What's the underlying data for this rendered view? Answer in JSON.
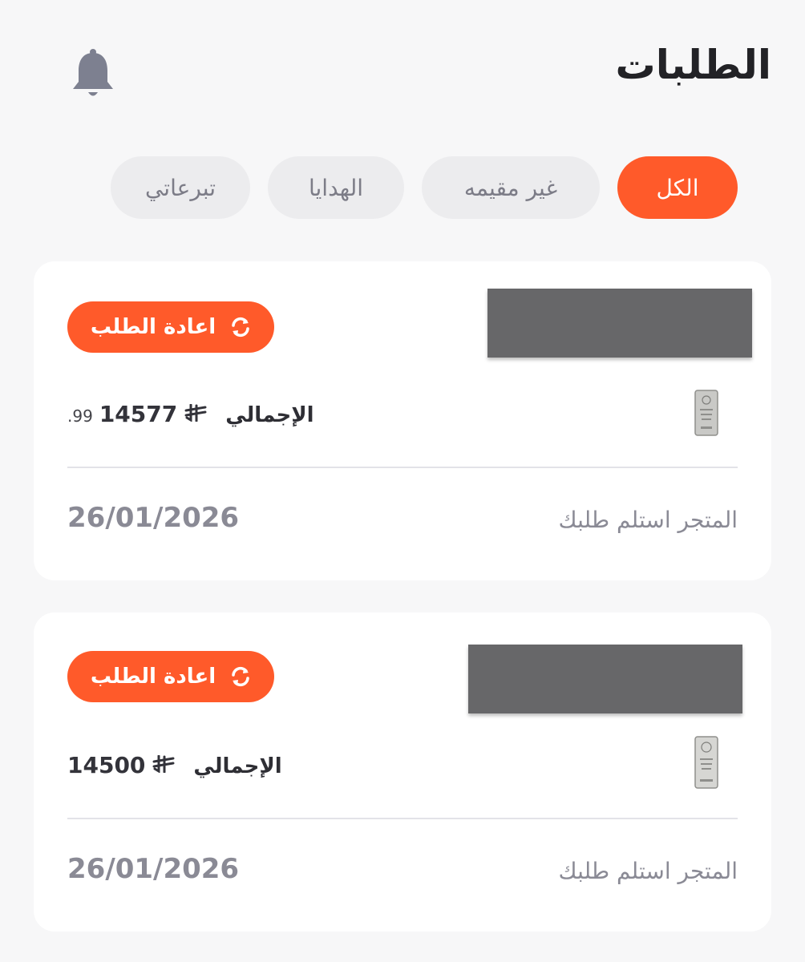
{
  "header": {
    "title": "الطلبات",
    "icon": "bell-icon"
  },
  "tabs": [
    {
      "label": "الكل",
      "active": true
    },
    {
      "label": "غير مقيمه",
      "active": false
    },
    {
      "label": "الهدايا",
      "active": false
    },
    {
      "label": "تبرعاتي",
      "active": false
    }
  ],
  "orders": [
    {
      "reorder_label": "اعادة الطلب",
      "total_label": "الإجمالي",
      "total_whole": "14577",
      "total_decimal": ".99",
      "currency_icon": "riyal-icon",
      "status": "المتجر استلم طلبك",
      "date": "26/01/2026"
    },
    {
      "reorder_label": "اعادة الطلب",
      "total_label": "الإجمالي",
      "total_whole": "14500",
      "total_decimal": "",
      "currency_icon": "riyal-icon",
      "status": "المتجر استلم طلبك",
      "date": "26/01/2026"
    }
  ],
  "colors": {
    "accent": "#ff5a2a",
    "background": "#f7f7f8",
    "card": "#ffffff",
    "muted_text": "#8a8a95",
    "banner": "#676769"
  }
}
